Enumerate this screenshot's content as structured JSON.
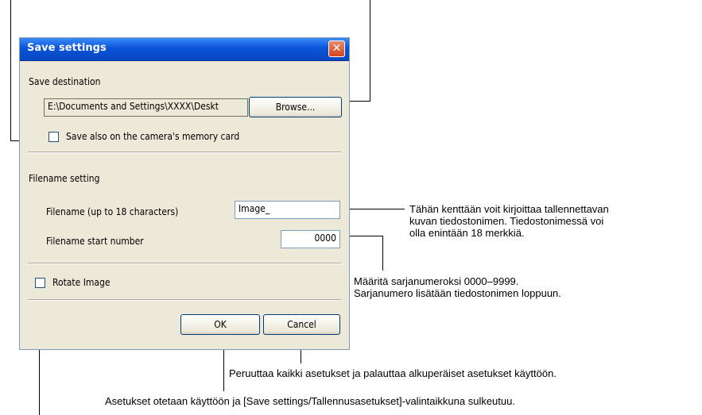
{
  "dialog": {
    "title": "Save settings",
    "save_destination_label": "Save destination",
    "path_value": "E:\\Documents and Settings\\XXXX\\Deskt",
    "browse_label": "Browse...",
    "save_card_label": "Save also on the camera's memory card",
    "save_card_checked": false,
    "filename_setting_label": "Filename setting",
    "filename_label": "Filename (up to 18 characters)",
    "filename_value": "Image_",
    "start_number_label": "Filename start number",
    "start_number_value": "0000",
    "rotate_label": "Rotate Image",
    "rotate_checked": false,
    "ok_label": "OK",
    "cancel_label": "Cancel",
    "close_glyph": "✕"
  },
  "annotations": {
    "filename_desc_1": "Tähän kenttään voit kirjoittaa tallennettavan",
    "filename_desc_2": "kuvan tiedostonimen. Tiedostonimessä voi",
    "filename_desc_3": "olla enintään 18 merkkiä.",
    "number_desc_1": "Määritä sarjanumeroksi 0000–9999.",
    "number_desc_2": "Sarjanumero lisätään tiedostonimen loppuun.",
    "cancel_desc": "Peruuttaa kaikki asetukset ja palauttaa alkuperäiset asetukset käyttöön.",
    "ok_desc": "Asetukset otetaan käyttöön ja [Save settings/Tallennusasetukset]-valintaikkuna sulkeutuu."
  },
  "colors": {
    "titlebar": "#0a54d8",
    "dialog_bg": "#ece9d8",
    "close_button": "#d2441f"
  }
}
